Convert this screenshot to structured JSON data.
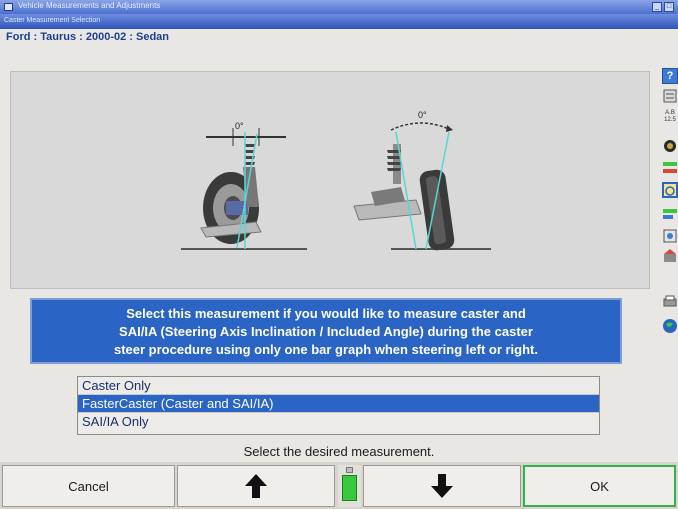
{
  "window": {
    "title": "Vehicle Measurements and Adjustments"
  },
  "screen": {
    "title": "Caster Measurement Selection"
  },
  "vehicle": "Ford : Taurus : 2000-02 : Sedan",
  "diagram": {
    "angle_left": "0°",
    "angle_right": "0°"
  },
  "description": [
    "Select this measurement if you would like to measure caster and",
    "SAI/IA (Steering Axis Inclination / Included Angle) during the caster",
    "steer procedure using only one bar graph when steering left or right."
  ],
  "options": [
    {
      "label": "Caster Only",
      "selected": false
    },
    {
      "label": "FasterCaster (Caster and SAI/IA)",
      "selected": true
    },
    {
      "label": "SAI/IA Only",
      "selected": false
    }
  ],
  "prompt": "Select the desired measurement.",
  "buttons": {
    "cancel": "Cancel",
    "ok": "OK",
    "up_icon": "arrow-up-icon",
    "down_icon": "arrow-down-icon"
  },
  "colors": {
    "accent": "#2a64c4",
    "ok_border": "#32b24a",
    "indicator": "#3cc83e"
  }
}
